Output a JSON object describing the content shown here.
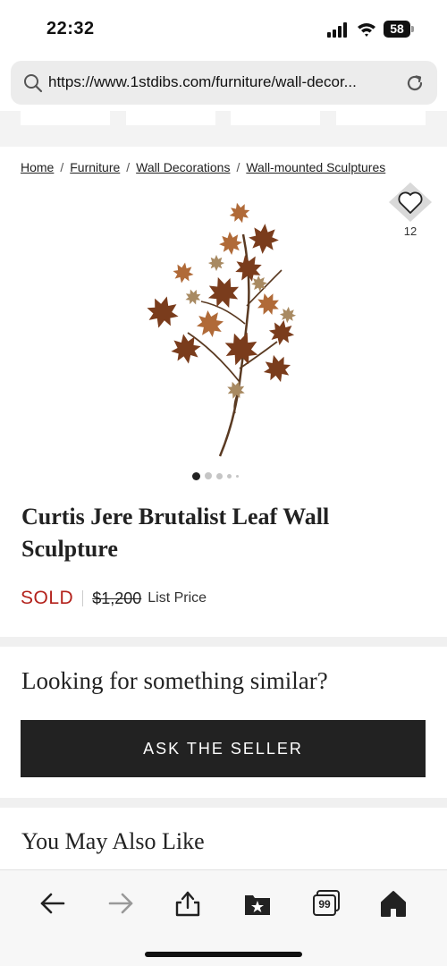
{
  "status_bar": {
    "time": "22:32",
    "battery": "58",
    "icons": [
      "signal-icon",
      "wifi-icon",
      "battery-icon"
    ]
  },
  "browser": {
    "url": "https://www.1stdibs.com/furniture/wall-decor...",
    "icons": [
      "search-icon",
      "reload-icon"
    ]
  },
  "breadcrumb": {
    "items": [
      "Home",
      "Furniture",
      "Wall Decorations",
      "Wall-mounted Sculptures"
    ],
    "separator": "/"
  },
  "favorite": {
    "count": "12",
    "icon": "heart-icon"
  },
  "carousel": {
    "total_dots": 5,
    "active_index": 0
  },
  "product": {
    "title": "Curtis Jere Brutalist Leaf Wall Sculpture",
    "status": "SOLD",
    "original_price": "$1,200",
    "price_label": "List Price"
  },
  "similar": {
    "heading": "Looking for something similar?",
    "button_label": "ASK THE SELLER"
  },
  "recommendations": {
    "heading": "You May Also Like"
  },
  "toolbar": {
    "tabs_count": "99",
    "icons": [
      "back-arrow-icon",
      "forward-arrow-icon",
      "share-icon",
      "bookmarks-icon",
      "tabs-icon",
      "home-icon"
    ]
  },
  "colors": {
    "sold": "#b3221c",
    "button_bg": "#222222",
    "url_bar_bg": "#ececec",
    "section_band": "#f0f0f0"
  }
}
